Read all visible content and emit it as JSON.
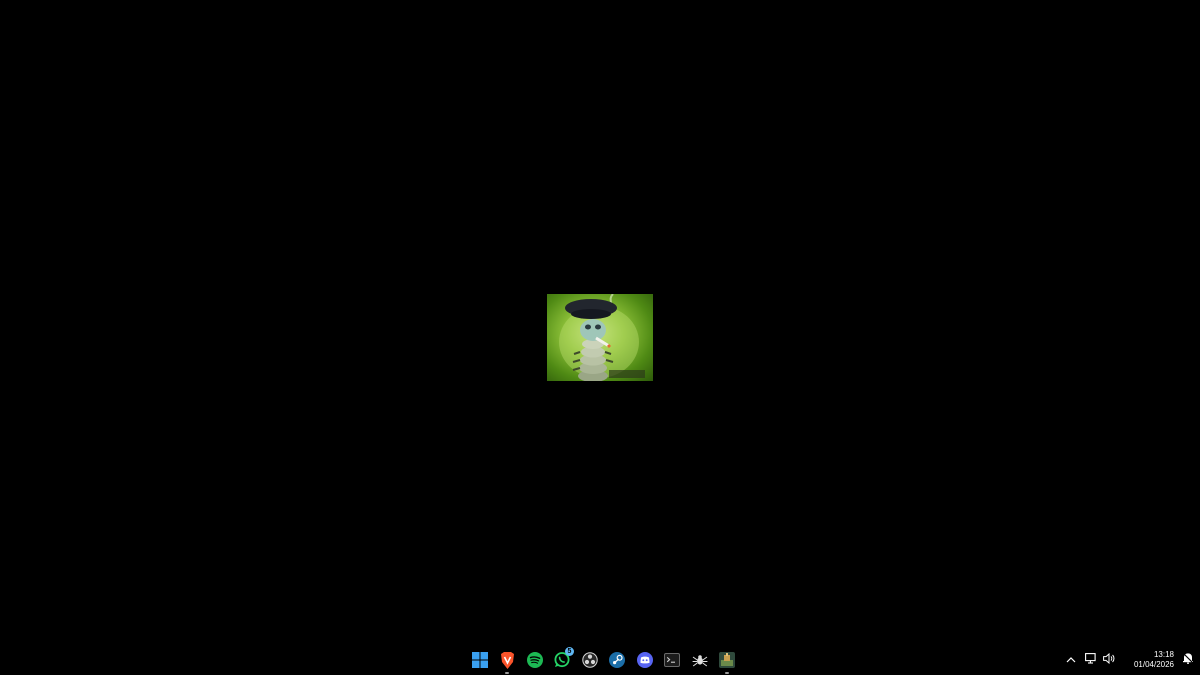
{
  "desktop": {
    "background_color": "#000000",
    "wallpaper": "centered-caterpillar-smoking-image"
  },
  "taskbar": {
    "apps": [
      {
        "name": "Start",
        "icon": "windows-start-icon",
        "running": false
      },
      {
        "name": "Brave",
        "icon": "brave-browser-icon",
        "running": true
      },
      {
        "name": "Spotify",
        "icon": "spotify-icon",
        "running": false
      },
      {
        "name": "WhatsApp",
        "icon": "whatsapp-icon",
        "running": false,
        "badge": "5"
      },
      {
        "name": "OBS Studio",
        "icon": "obs-icon",
        "running": false
      },
      {
        "name": "Steam",
        "icon": "steam-icon",
        "running": false
      },
      {
        "name": "Discord",
        "icon": "discord-icon",
        "running": false
      },
      {
        "name": "Terminal",
        "icon": "terminal-icon",
        "running": false
      },
      {
        "name": "Spider app",
        "icon": "spider-icon",
        "running": false
      },
      {
        "name": "Game",
        "icon": "game-icon",
        "running": true
      }
    ],
    "whatsapp_badge": "5"
  },
  "tray": {
    "time": "13:18",
    "date": "01/04/2026",
    "icons": [
      "chevron-up-icon",
      "network-icon",
      "volume-icon",
      "notification-bell-icon"
    ]
  },
  "colors": {
    "brave": "#fb542b",
    "spotify": "#1db954",
    "whatsapp": "#25d366",
    "steam": "#1b6ea8",
    "discord": "#5865f2",
    "windows": "#3aa0f0",
    "badge": "#5fb6f2"
  }
}
